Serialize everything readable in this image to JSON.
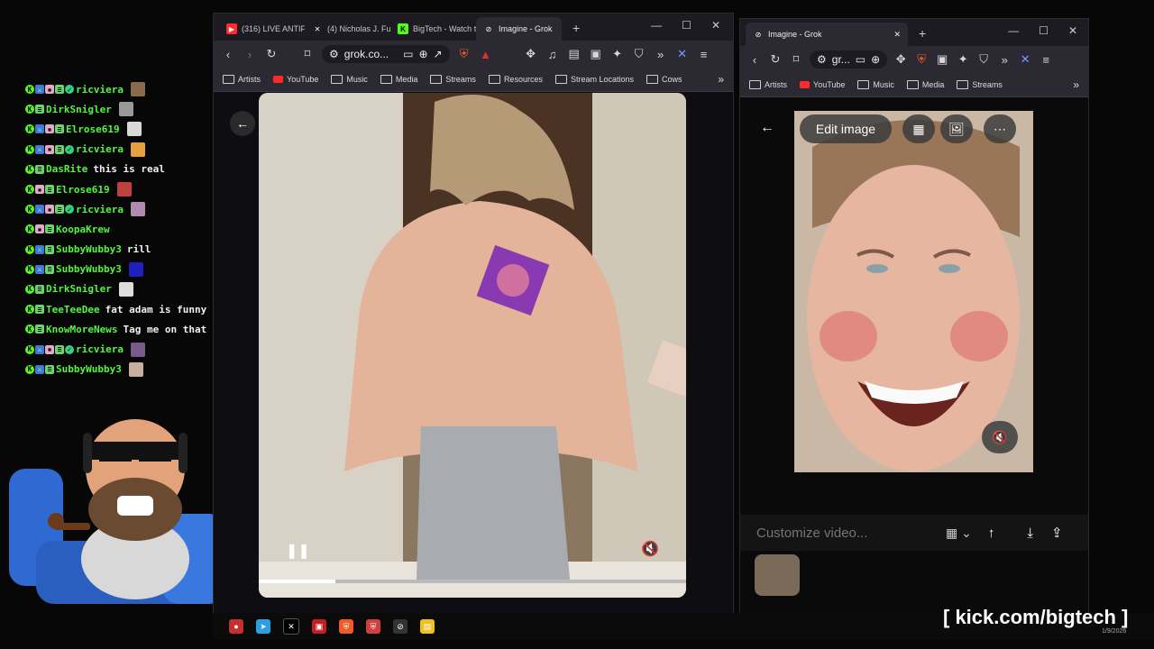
{
  "chat": {
    "messages": [
      {
        "user": "ricviera",
        "text": "",
        "badges": [
          "k",
          "x",
          "p",
          "g",
          "v"
        ],
        "emote": "#8a6a4a"
      },
      {
        "user": "DirkSnigler",
        "text": "",
        "badges": [
          "k",
          "g"
        ],
        "emote": "#9a9a9a"
      },
      {
        "user": "Elrose619",
        "text": "",
        "badges": [
          "k",
          "x",
          "p",
          "g"
        ],
        "emote": "#d9d9d9"
      },
      {
        "user": "ricviera",
        "text": "",
        "badges": [
          "k",
          "x",
          "p",
          "g",
          "v"
        ],
        "emote": "#e6a040"
      },
      {
        "user": "DasRite",
        "text": "this is real",
        "badges": [
          "k",
          "g"
        ],
        "emote": ""
      },
      {
        "user": "Elrose619",
        "text": "",
        "badges": [
          "k",
          "p",
          "g"
        ],
        "emote": "#c04040"
      },
      {
        "user": "ricviera",
        "text": "",
        "badges": [
          "k",
          "x",
          "p",
          "g",
          "v"
        ],
        "emote": "#b08ab0"
      },
      {
        "user": "KoopaKrew",
        "text": "",
        "badges": [
          "k",
          "p",
          "g"
        ],
        "emote": ""
      },
      {
        "user": "SubbyWubby3",
        "text": "rill",
        "badges": [
          "k",
          "x",
          "g"
        ],
        "emote": ""
      },
      {
        "user": "SubbyWubby3",
        "text": "",
        "badges": [
          "k",
          "x",
          "g"
        ],
        "emote": "#2020c0"
      },
      {
        "user": "DirkSnigler",
        "text": "",
        "badges": [
          "k",
          "g"
        ],
        "emote": "#dddddd"
      },
      {
        "user": "TeeTeeDee",
        "text": "fat adam is funny",
        "badges": [
          "k",
          "g"
        ],
        "emote": ""
      },
      {
        "user": "KnowMoreNews",
        "text": "Tag me on that",
        "badges": [
          "k",
          "g"
        ],
        "emote": ""
      },
      {
        "user": "ricviera",
        "text": "",
        "badges": [
          "k",
          "x",
          "p",
          "g",
          "v"
        ],
        "emote": "#7a5a8a"
      },
      {
        "user": "SubbyWubby3",
        "text": "",
        "badges": [
          "k",
          "x",
          "g"
        ],
        "emote": "#c8b0a0"
      }
    ]
  },
  "left_browser": {
    "tabs": [
      {
        "label": "(316) LIVE ANTIFA",
        "fav_color": "#ff2a2a",
        "fav_icon": "youtube-icon"
      },
      {
        "label": "(4) Nicholas J. Fue",
        "fav_color": "#000000",
        "fav_icon": "x-icon"
      },
      {
        "label": "BigTech - Watch th",
        "fav_color": "#53fc18",
        "fav_icon": "kick-icon"
      },
      {
        "label": "Imagine - Grok",
        "fav_color": "#2b2a33",
        "fav_icon": "grok-icon",
        "active": true
      }
    ],
    "url": "grok.co...",
    "bookmarks": [
      {
        "label": "Artists",
        "icon": "folder"
      },
      {
        "label": "YouTube",
        "icon": "youtube"
      },
      {
        "label": "Music",
        "icon": "folder"
      },
      {
        "label": "Media",
        "icon": "folder"
      },
      {
        "label": "Streams",
        "icon": "folder"
      },
      {
        "label": "Resources",
        "icon": "folder"
      },
      {
        "label": "Stream Locations",
        "icon": "folder"
      },
      {
        "label": "Cows",
        "icon": "folder"
      }
    ]
  },
  "right_browser": {
    "tab_label": "Imagine - Grok",
    "url": "gr...",
    "bookmarks": [
      {
        "label": "Artists",
        "icon": "folder"
      },
      {
        "label": "YouTube",
        "icon": "youtube"
      },
      {
        "label": "Music",
        "icon": "folder"
      },
      {
        "label": "Media",
        "icon": "folder"
      },
      {
        "label": "Streams",
        "icon": "folder"
      }
    ],
    "edit_image_label": "Edit image",
    "customize_placeholder": "Customize video..."
  },
  "watermark": "[ kick.com/bigtech ]",
  "clock_date": "1/9/2026",
  "colors": {
    "kick_green": "#53fc18",
    "chat_name": "#54f541",
    "browser_bg": "#2b2a33"
  }
}
